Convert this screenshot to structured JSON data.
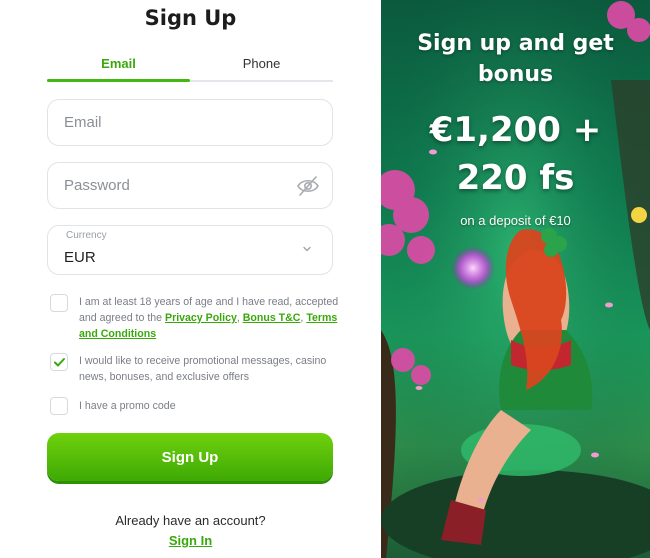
{
  "form": {
    "title": "Sign Up",
    "tabs": {
      "email": "Email",
      "phone": "Phone"
    },
    "email_placeholder": "Email",
    "password_placeholder": "Password",
    "currency": {
      "label": "Currency",
      "value": "EUR"
    },
    "age_text_before": "I am at least 18 years of age and I have read, accepted and agreed to the ",
    "privacy_link": "Privacy Policy",
    "comma1": ", ",
    "bonus_link": "Bonus T&C",
    "comma2": ", ",
    "terms_link": "Terms and Conditions",
    "promo_opt_in": "I would like to receive promotional messages, casino news, bonuses, and exclusive offers",
    "promo_code": "I have a promo code",
    "submit": "Sign Up",
    "already": "Already have an account?",
    "sign_in": "Sign In"
  },
  "promo": {
    "headline": "Sign up and get bonus",
    "amount_line1": "€1,200 +",
    "amount_line2": "220 fs",
    "subline": "on a deposit of €10"
  },
  "colors": {
    "accent": "#43b90f",
    "button_top": "#6fd10c",
    "button_bottom": "#3fa905"
  },
  "icons": [
    "eye-off-icon",
    "chevron-down-icon",
    "checkmark-icon"
  ]
}
